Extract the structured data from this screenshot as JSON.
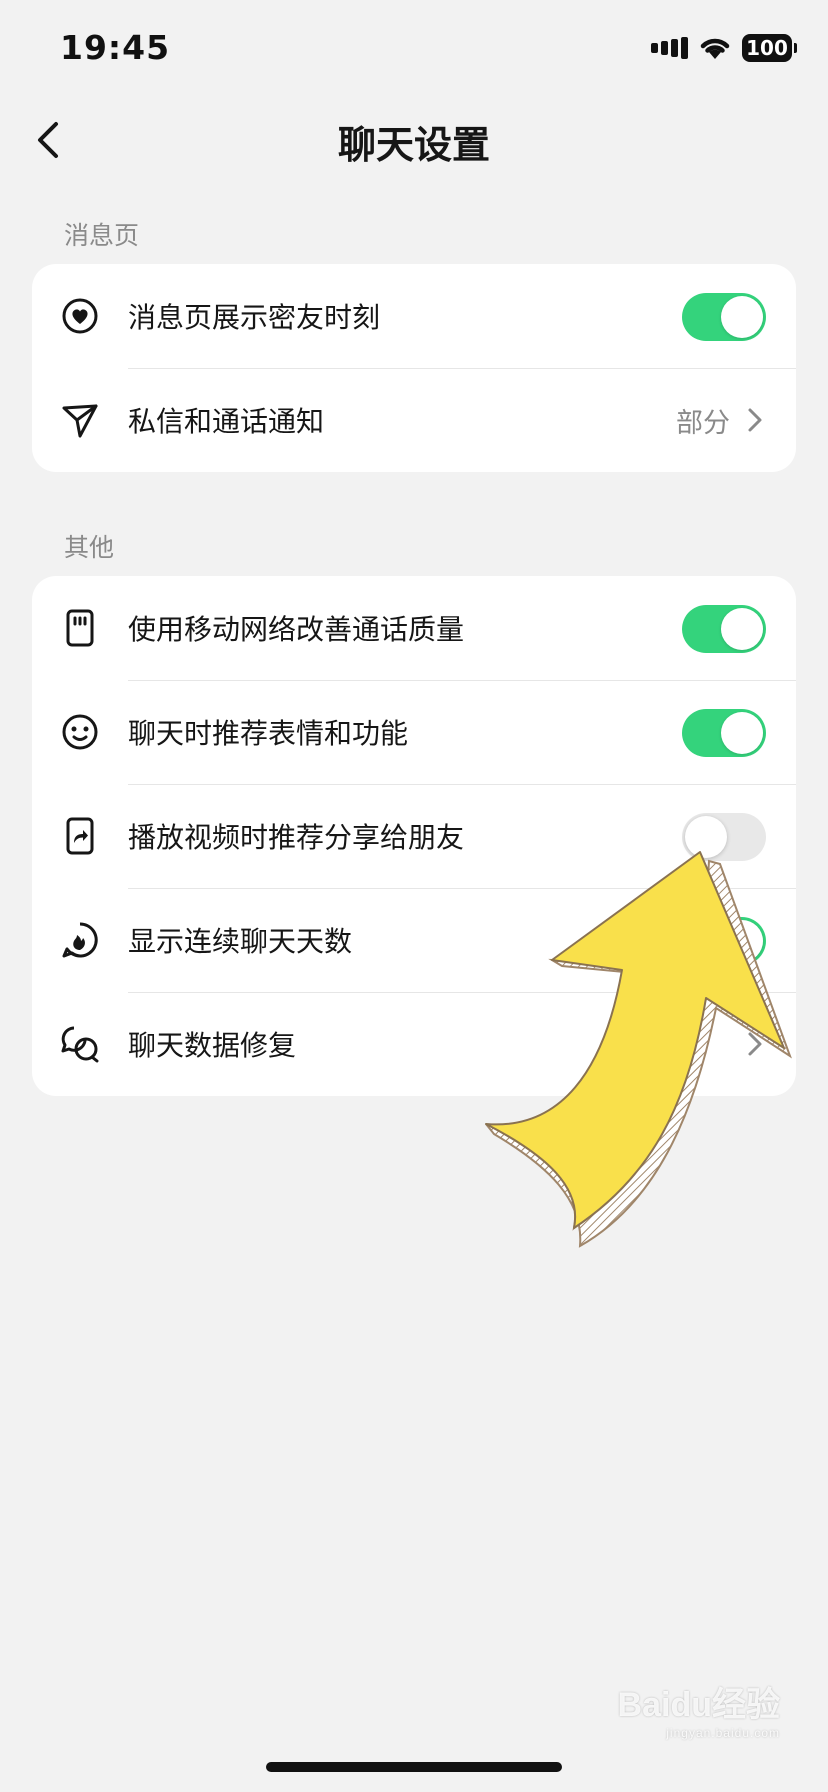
{
  "status_bar": {
    "time": "19:45",
    "battery": "100",
    "icons": [
      "signal-icon",
      "wifi-icon",
      "battery-icon"
    ]
  },
  "header": {
    "title": "聊天设置",
    "back_icon": "chevron-left-icon"
  },
  "sections": [
    {
      "label": "消息页",
      "items": [
        {
          "icon": "heart-circle-icon",
          "label": "消息页展示密友时刻",
          "control": "toggle",
          "on": true
        },
        {
          "icon": "send-icon",
          "label": "私信和通话通知",
          "control": "value",
          "value": "部分"
        }
      ]
    },
    {
      "label": "其他",
      "items": [
        {
          "icon": "sim-card-icon",
          "label": "使用移动网络改善通话质量",
          "control": "toggle",
          "on": true
        },
        {
          "icon": "smiley-icon",
          "label": "聊天时推荐表情和功能",
          "control": "toggle",
          "on": true
        },
        {
          "icon": "share-card-icon",
          "label": "播放视频时推荐分享给朋友",
          "control": "toggle",
          "on": false
        },
        {
          "icon": "flame-chat-icon",
          "label": "显示连续聊天天数",
          "control": "toggle",
          "on": true
        },
        {
          "icon": "chat-bubbles-icon",
          "label": "聊天数据修复",
          "control": "chevron"
        }
      ]
    }
  ],
  "overlay": {
    "arrow_icon": "yellow-arrow-icon",
    "arrow_color": "#f9e04b"
  },
  "watermark": {
    "main": "Baidu经验",
    "sub": "jingyan.baidu.com"
  },
  "colors": {
    "toggle_on": "#34d37c",
    "toggle_off": "#e8e8e8",
    "background": "#f2f2f2",
    "card": "#ffffff"
  }
}
